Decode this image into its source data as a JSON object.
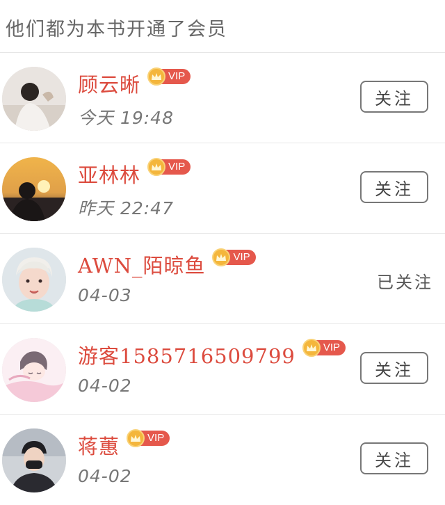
{
  "header": {
    "title": "他们都为本书开通了会员"
  },
  "members": [
    {
      "name": "顾云晰",
      "vip_label": "VIP",
      "time": "今天 19:48",
      "action": "关注",
      "followed": false
    },
    {
      "name": "亚林林",
      "vip_label": "VIP",
      "time": "昨天 22:47",
      "action": "关注",
      "followed": false
    },
    {
      "name": "AWN_陌晾鱼",
      "vip_label": "VIP",
      "time": "04-03",
      "action": "已关注",
      "followed": true
    },
    {
      "name": "游客1585716509799",
      "vip_label": "VIP",
      "time": "04-02",
      "action": "关注",
      "followed": false
    },
    {
      "name": "蒋蕙",
      "vip_label": "VIP",
      "time": "04-02",
      "action": "关注",
      "followed": false
    }
  ],
  "colors": {
    "name": "#dc4b3e",
    "vip_badge": "#e5584c",
    "crown": "#f4b63c"
  },
  "icons": {
    "vip": "crown-icon"
  }
}
